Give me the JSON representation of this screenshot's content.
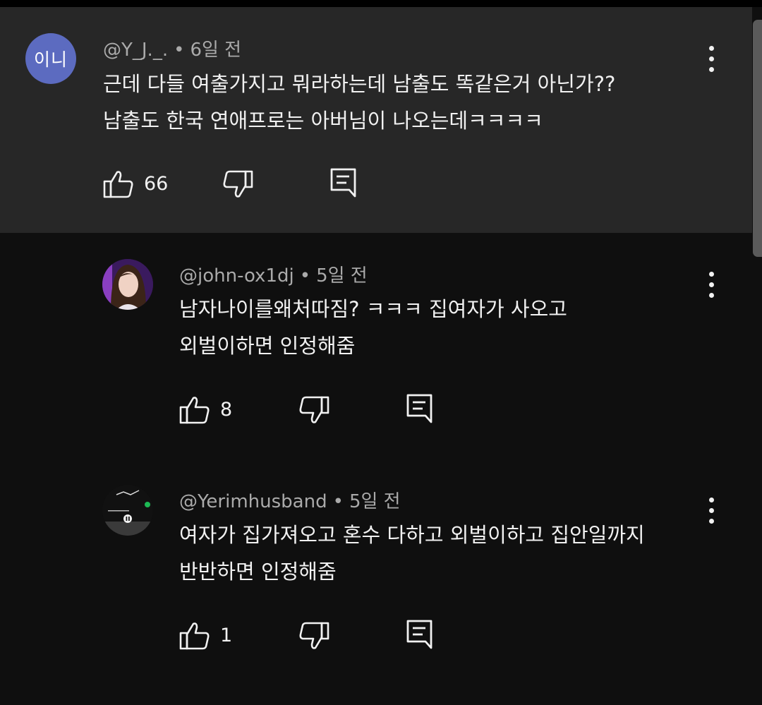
{
  "comments": [
    {
      "avatar_text": "이니",
      "author": "@Y_J._.",
      "separator": "•",
      "time": "6일 전",
      "lines": [
        "근데 다들 여출가지고 뭐라하는데 남출도 똑같은거 아닌가??",
        "남출도 한국 연애프로는 아버님이 나오는데ㅋㅋㅋㅋ"
      ],
      "likes": "66"
    },
    {
      "author": "@john-ox1dj",
      "separator": "•",
      "time": "5일 전",
      "lines": [
        "남자나이를왜처따짐? ㅋㅋㅋ 집여자가 사오고",
        "외벌이하면 인정해줌"
      ],
      "likes": "8"
    },
    {
      "author": "@Yerimhusband",
      "separator": "•",
      "time": "5일 전",
      "lines": [
        "여자가 집가져오고 혼수 다하고 외벌이하고 집안일까지",
        "반반하면 인정해줌"
      ],
      "likes": "1"
    }
  ],
  "colors": {
    "background": "#0f0f0f",
    "highlight": "#272727",
    "avatar_bg": "#5c6bc0",
    "meta_text": "#aaaaaa"
  }
}
